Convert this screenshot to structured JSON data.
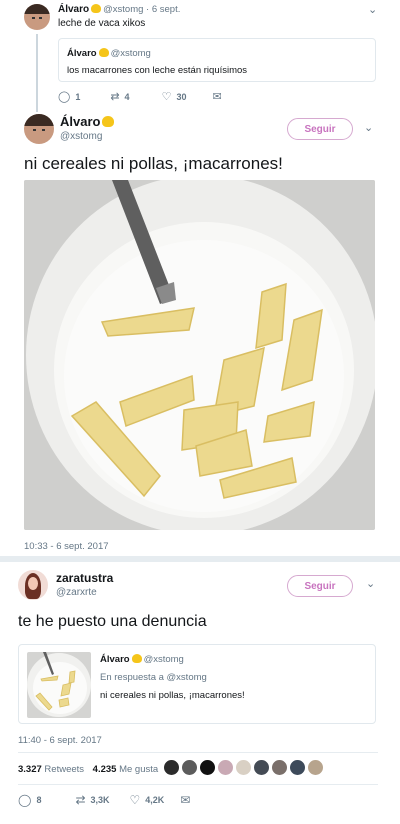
{
  "tweet1": {
    "name": "Álvaro",
    "meta": "@xstomg · 6 sept.",
    "text": "leche de vaca xikos",
    "quote": {
      "name": "Álvaro",
      "handle": "@xstomg",
      "text": "los macarrones con leche están riquísimos"
    },
    "actions": {
      "replies": "1",
      "retweets": "4",
      "likes": "30"
    }
  },
  "tweet2": {
    "name": "Álvaro",
    "handle": "@xstomg",
    "follow_label": "Seguir",
    "text": "ni cereales ni pollas, ¡macarrones!",
    "timestamp": "10:33 - 6 sept. 2017"
  },
  "tweet3": {
    "name": "zaratustra",
    "handle": "@zarxrte",
    "follow_label": "Seguir",
    "text": "te he puesto una denuncia",
    "quote": {
      "name": "Álvaro",
      "handle": "@xstomg",
      "reply_to": "En respuesta a @xstomg",
      "text": "ni cereales ni pollas, ¡macarrones!"
    },
    "timestamp": "11:40 - 6 sept. 2017",
    "stats": {
      "retweets_count": "3.327",
      "retweets_label": "Retweets",
      "likes_count": "4.235",
      "likes_label": "Me gusta"
    },
    "actions": {
      "replies": "8",
      "retweets": "3,3K",
      "likes": "4,2K"
    }
  },
  "colors": {
    "follow": "#c874bf",
    "muted": "#657786",
    "background": "#e6ecf0"
  }
}
